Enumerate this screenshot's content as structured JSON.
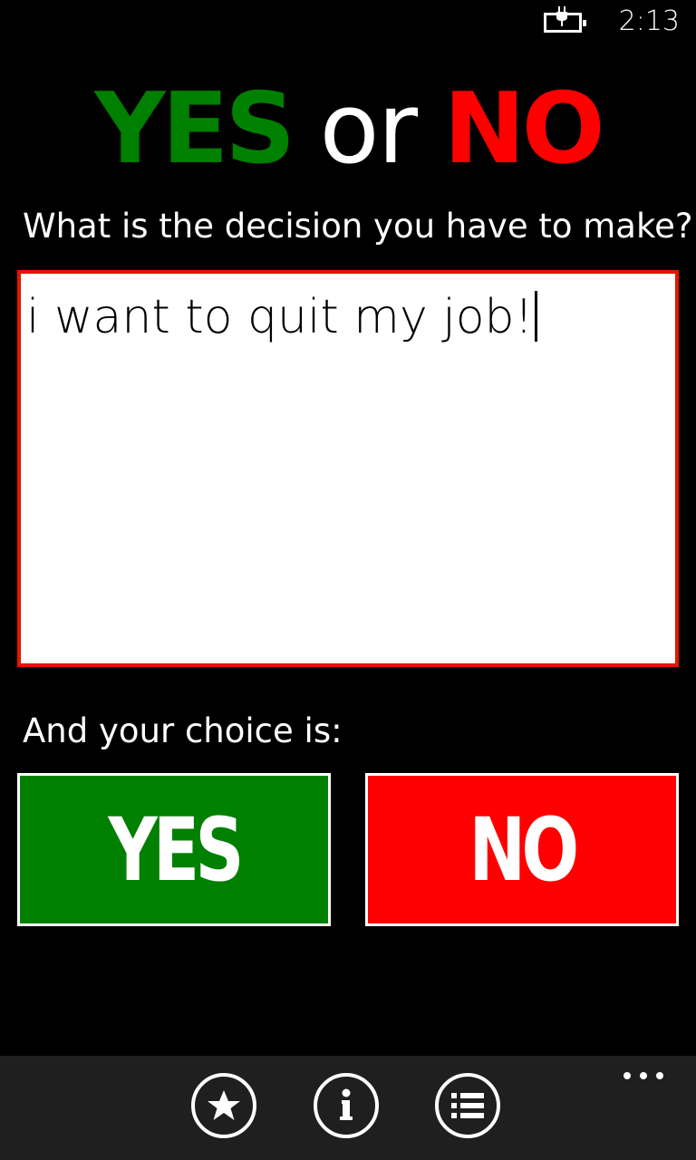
{
  "status_bar": {
    "time": "2:13",
    "battery_icon": "battery-charging-icon"
  },
  "header": {
    "title_yes": "YES",
    "title_or": "or",
    "title_no": "NO"
  },
  "question": {
    "label": "What is the decision you have to make?",
    "input_value": "i want to quit my job!"
  },
  "choice": {
    "label": "And your choice is:",
    "yes_label": "YES",
    "no_label": "NO"
  },
  "app_bar": {
    "buttons": [
      {
        "icon": "star-icon"
      },
      {
        "icon": "info-icon"
      },
      {
        "icon": "list-icon"
      }
    ],
    "more_icon": "more-dots-icon"
  },
  "colors": {
    "background": "#000000",
    "yes_green": "#008000",
    "no_red": "#ff0000",
    "input_border": "#e51400",
    "app_bar": "#1f1f1f",
    "text": "#ffffff"
  }
}
